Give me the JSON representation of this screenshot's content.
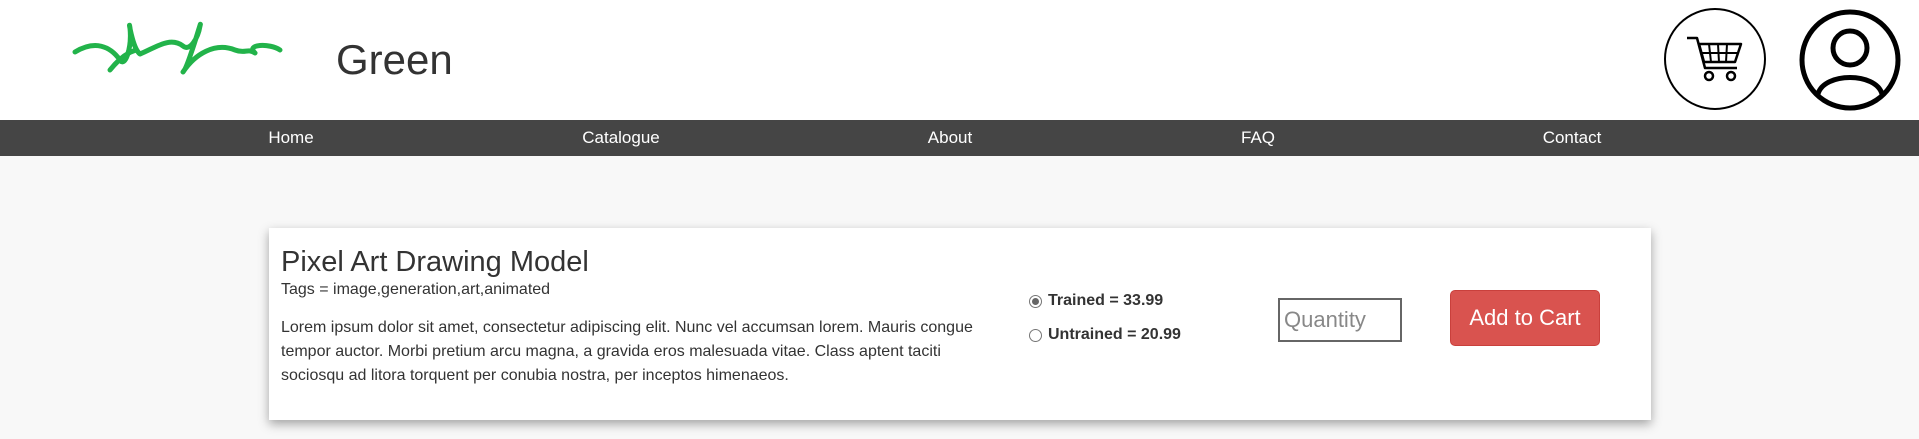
{
  "header": {
    "brand": "Green",
    "logo_icon": "green-squiggle-logo",
    "cart_icon": "shopping-cart-icon",
    "user_icon": "user-account-icon"
  },
  "nav": {
    "items": [
      {
        "label": "Home"
      },
      {
        "label": "Catalogue"
      },
      {
        "label": "About"
      },
      {
        "label": "FAQ"
      },
      {
        "label": "Contact"
      }
    ]
  },
  "product": {
    "title": "Pixel Art Drawing Model",
    "tags": "Tags = image,generation,art,animated",
    "description": "Lorem ipsum dolor sit amet, consectetur adipiscing elit. Nunc vel accumsan lorem. Mauris congue tempor auctor. Morbi pretium arcu magna, a gravida eros malesuada vitae. Class aptent taciti sociosqu ad litora torquent per conubia nostra, per inceptos himenaeos.",
    "options": [
      {
        "label": "Trained = 33.99",
        "selected": true
      },
      {
        "label": "Untrained = 20.99",
        "selected": false
      }
    ],
    "quantity": {
      "value": "",
      "placeholder": "Quantity"
    },
    "add_to_cart_label": "Add to Cart"
  },
  "colors": {
    "logo_green": "#22b34a",
    "navbar_bg": "#454545",
    "page_bg": "#f8f8f8",
    "button_red": "#d9534f"
  }
}
